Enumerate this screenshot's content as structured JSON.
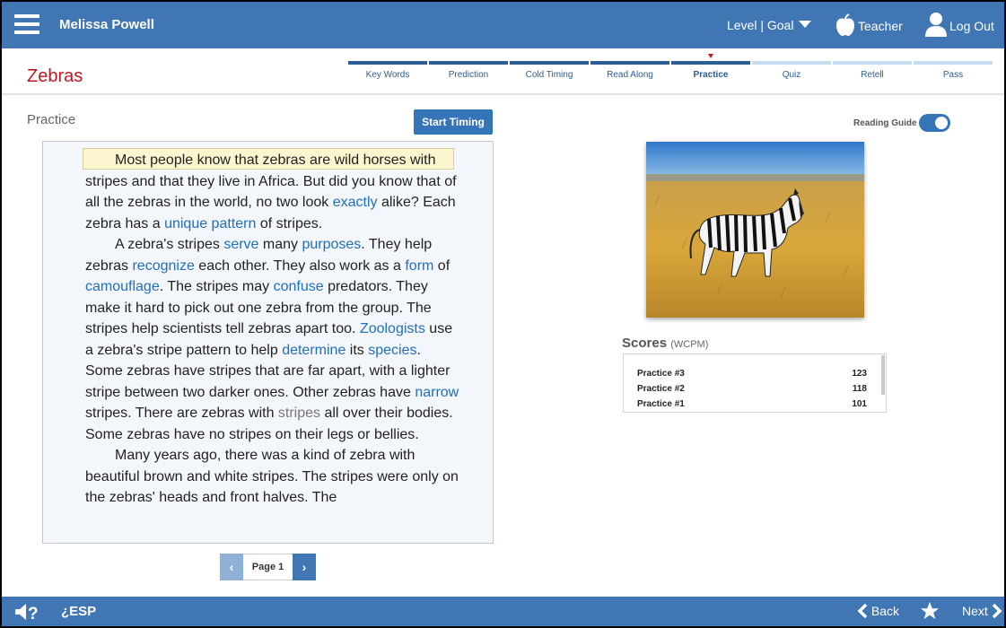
{
  "header": {
    "user_name": "Melissa Powell",
    "level_goal": "Level | Goal",
    "teacher": "Teacher",
    "logout": "Log Out",
    "bar_color": "#3f76b3"
  },
  "title": "Zebras",
  "steps": [
    {
      "label": "Key Words",
      "state": "done"
    },
    {
      "label": "Prediction",
      "state": "done"
    },
    {
      "label": "Cold Timing",
      "state": "done"
    },
    {
      "label": "Read Along",
      "state": "done"
    },
    {
      "label": "Practice",
      "state": "current"
    },
    {
      "label": "Quiz",
      "state": "future"
    },
    {
      "label": "Retell",
      "state": "future"
    },
    {
      "label": "Pass",
      "state": "future"
    }
  ],
  "practice": {
    "section_label": "Practice",
    "start_timing": "Start Timing",
    "page_label": "Page 1"
  },
  "passage": {
    "p1": [
      "Most people know that zebras are wild horses with stripes and that they live in Africa. But did you know that of all the zebras in the world, no two look ",
      "exactly",
      " alike? Each zebra has a ",
      "unique pattern",
      " of stripes."
    ],
    "p2": [
      "A zebra's stripes ",
      "serve",
      " many ",
      "purposes",
      ". They help zebras ",
      "recognize",
      " each other. They also work as a ",
      "form",
      " of ",
      "camouflage",
      ". The stripes may ",
      "confuse",
      " predators. They make it hard to pick out one zebra from the group. The stripes help scientists tell zebras apart too. ",
      "Zoologists",
      " use a zebra's stripe pattern to help ",
      "determine",
      " its ",
      "species",
      ". Some zebras have stripes that are far apart, with a lighter stripe between two darker ones. Other zebras have ",
      "narrow",
      " stripes. There are zebras with ",
      "stripes",
      " all over their bodies. Some zebras have no stripes on their legs or bellies."
    ],
    "p3": [
      "Many years ago, there was a kind of zebra with beautiful brown and white stripes. The stripes were only on the zebras' heads and front halves. The"
    ]
  },
  "reading_guide": {
    "label": "Reading Guide",
    "on": true
  },
  "scores": {
    "label": "Scores",
    "unit": "(WCPM)",
    "rows": [
      {
        "name": "Practice #3",
        "value": "123"
      },
      {
        "name": "Practice #2",
        "value": "118"
      },
      {
        "name": "Practice #1",
        "value": "101"
      }
    ]
  },
  "footer": {
    "esp": "¿ESP",
    "back": "Back",
    "next": "Next"
  }
}
